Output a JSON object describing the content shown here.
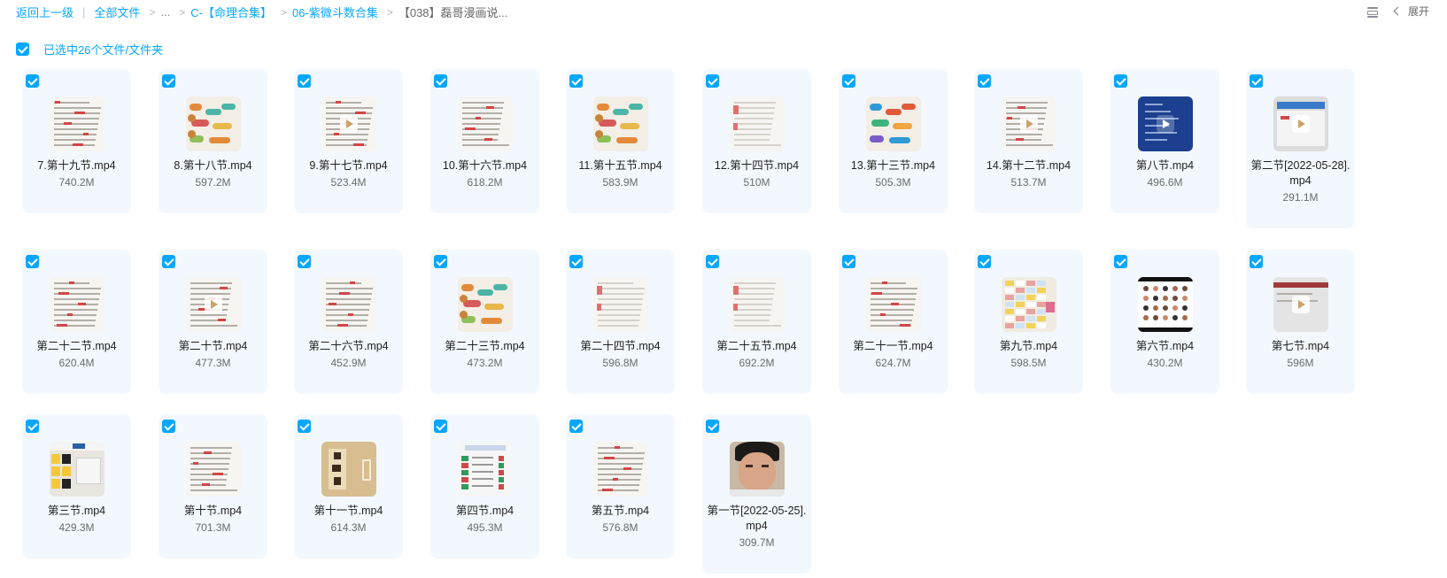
{
  "breadcrumb": {
    "back": "返回上一级",
    "all_files": "全部文件",
    "ellipsis": "...",
    "level1": "C-【命理合集】",
    "level2": "06-紫微斗数合集",
    "current": "【038】磊哥漫画说..."
  },
  "toolbar": {
    "expand": "展开"
  },
  "selection": {
    "label": "已选中26个文件/文件夹"
  },
  "colors": {
    "accent": "#06a7ff",
    "card_bg": "#f2f8fd"
  },
  "files": [
    {
      "name": "7.第十九节.mp4",
      "size": "740.2M",
      "thumb": "doc"
    },
    {
      "name": "8.第十八节.mp4",
      "size": "597.2M",
      "thumb": "mind"
    },
    {
      "name": "9.第十七节.mp4",
      "size": "523.4M",
      "thumb": "doc-play"
    },
    {
      "name": "10.第十六节.mp4",
      "size": "618.2M",
      "thumb": "doc"
    },
    {
      "name": "11.第十五节.mp4",
      "size": "583.9M",
      "thumb": "mind"
    },
    {
      "name": "12.第十四节.mp4",
      "size": "510M",
      "thumb": "doc-light"
    },
    {
      "name": "13.第十三节.mp4",
      "size": "505.3M",
      "thumb": "mind-blue"
    },
    {
      "name": "14.第十二节.mp4",
      "size": "513.7M",
      "thumb": "doc-play"
    },
    {
      "name": "第八节.mp4",
      "size": "496.6M",
      "thumb": "blue-play"
    },
    {
      "name": "第二节[2022-05-28].mp4",
      "size": "291.1M",
      "thumb": "screen"
    },
    {
      "name": "第二十二节.mp4",
      "size": "620.4M",
      "thumb": "doc"
    },
    {
      "name": "第二十节.mp4",
      "size": "477.3M",
      "thumb": "doc-play"
    },
    {
      "name": "第二十六节.mp4",
      "size": "452.9M",
      "thumb": "doc"
    },
    {
      "name": "第二十三节.mp4",
      "size": "473.2M",
      "thumb": "mind"
    },
    {
      "name": "第二十四节.mp4",
      "size": "596.8M",
      "thumb": "doc-light"
    },
    {
      "name": "第二十五节.mp4",
      "size": "692.2M",
      "thumb": "doc-light"
    },
    {
      "name": "第二十一节.mp4",
      "size": "624.7M",
      "thumb": "doc"
    },
    {
      "name": "第九节.mp4",
      "size": "598.5M",
      "thumb": "table"
    },
    {
      "name": "第六节.mp4",
      "size": "430.2M",
      "thumb": "people"
    },
    {
      "name": "第七节.mp4",
      "size": "596M",
      "thumb": "screen-red"
    },
    {
      "name": "第三节.mp4",
      "size": "429.3M",
      "thumb": "grid-yellow"
    },
    {
      "name": "第十节.mp4",
      "size": "701.3M",
      "thumb": "doc"
    },
    {
      "name": "第十一节.mp4",
      "size": "614.3M",
      "thumb": "calligraphy"
    },
    {
      "name": "第四节.mp4",
      "size": "495.3M",
      "thumb": "table2"
    },
    {
      "name": "第五节.mp4",
      "size": "576.8M",
      "thumb": "doc"
    },
    {
      "name": "第一节[2022-05-25].mp4",
      "size": "309.7M",
      "thumb": "face"
    }
  ]
}
